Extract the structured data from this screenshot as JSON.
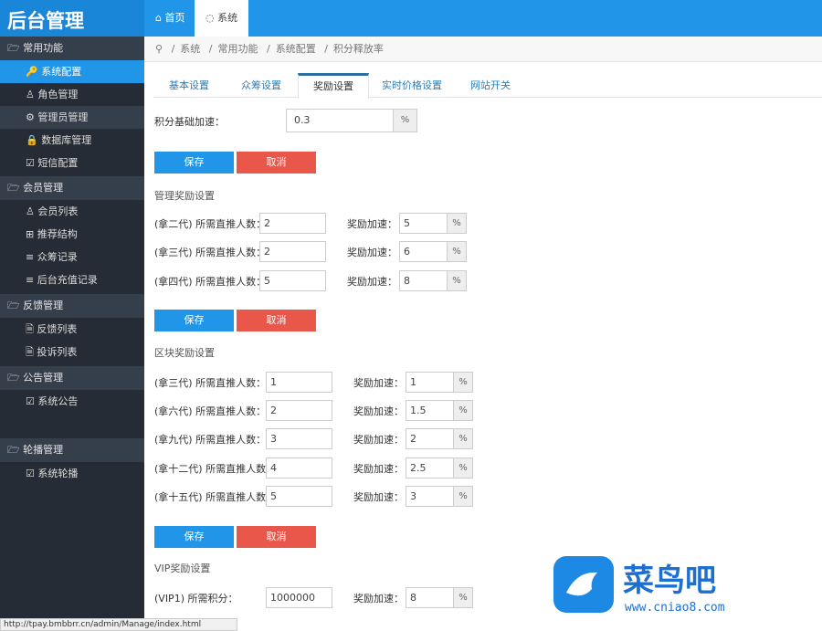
{
  "header": {
    "logo": "后台管理",
    "tabs": [
      {
        "label": "⌂ 首页"
      },
      {
        "label": "◌ 系统"
      }
    ]
  },
  "sidebar": {
    "groups": [
      {
        "label": "常用功能",
        "items": [
          "系统配置",
          "角色管理",
          "管理员管理",
          "数据库管理",
          "短信配置"
        ]
      },
      {
        "label": "会员管理",
        "items": [
          "会员列表",
          "推荐结构",
          "众筹记录",
          "后台充值记录"
        ]
      },
      {
        "label": "反馈管理",
        "items": [
          "反馈列表",
          "投诉列表"
        ]
      },
      {
        "label": "公告管理",
        "items": [
          "系统公告"
        ]
      },
      {
        "label": "轮播管理",
        "items": [
          "系统轮播"
        ]
      }
    ]
  },
  "breadcrumb": [
    "系统",
    "常用功能",
    "系统配置",
    "积分释放率"
  ],
  "tabs": [
    "基本设置",
    "众筹设置",
    "奖励设置",
    "实时价格设置",
    "网站开关"
  ],
  "form": {
    "base": {
      "label": "积分基础加速：",
      "value": "0.3",
      "unit": "%"
    },
    "save": "保存",
    "cancel": "取消",
    "speed_label": "奖励加速：",
    "manage": {
      "title": "管理奖励设置",
      "rows": [
        {
          "label": "(拿二代) 所需直推人数：",
          "count": "2",
          "speed": "5"
        },
        {
          "label": "(拿三代) 所需直推人数：",
          "count": "2",
          "speed": "6"
        },
        {
          "label": "(拿四代) 所需直推人数：",
          "count": "5",
          "speed": "8"
        }
      ]
    },
    "block": {
      "title": "区块奖励设置",
      "rows": [
        {
          "label": "(拿三代) 所需直推人数：",
          "count": "1",
          "speed": "1"
        },
        {
          "label": "(拿六代) 所需直推人数：",
          "count": "2",
          "speed": "1.5"
        },
        {
          "label": "(拿九代) 所需直推人数：",
          "count": "3",
          "speed": "2"
        },
        {
          "label": "(拿十二代) 所需直推人数：",
          "count": "4",
          "speed": "2.5"
        },
        {
          "label": "(拿十五代) 所需直推人数：",
          "count": "5",
          "speed": "3"
        }
      ]
    },
    "vip": {
      "title": "VIP奖励设置",
      "rows": [
        {
          "label": "(VIP1) 所需积分：",
          "count": "1000000",
          "speed": "8"
        }
      ]
    }
  },
  "status_url": "http://tpay.bmbbrr.cn/admin/Manage/index.html",
  "watermark": {
    "name": "菜鸟吧",
    "url": "www.cniao8.com"
  }
}
